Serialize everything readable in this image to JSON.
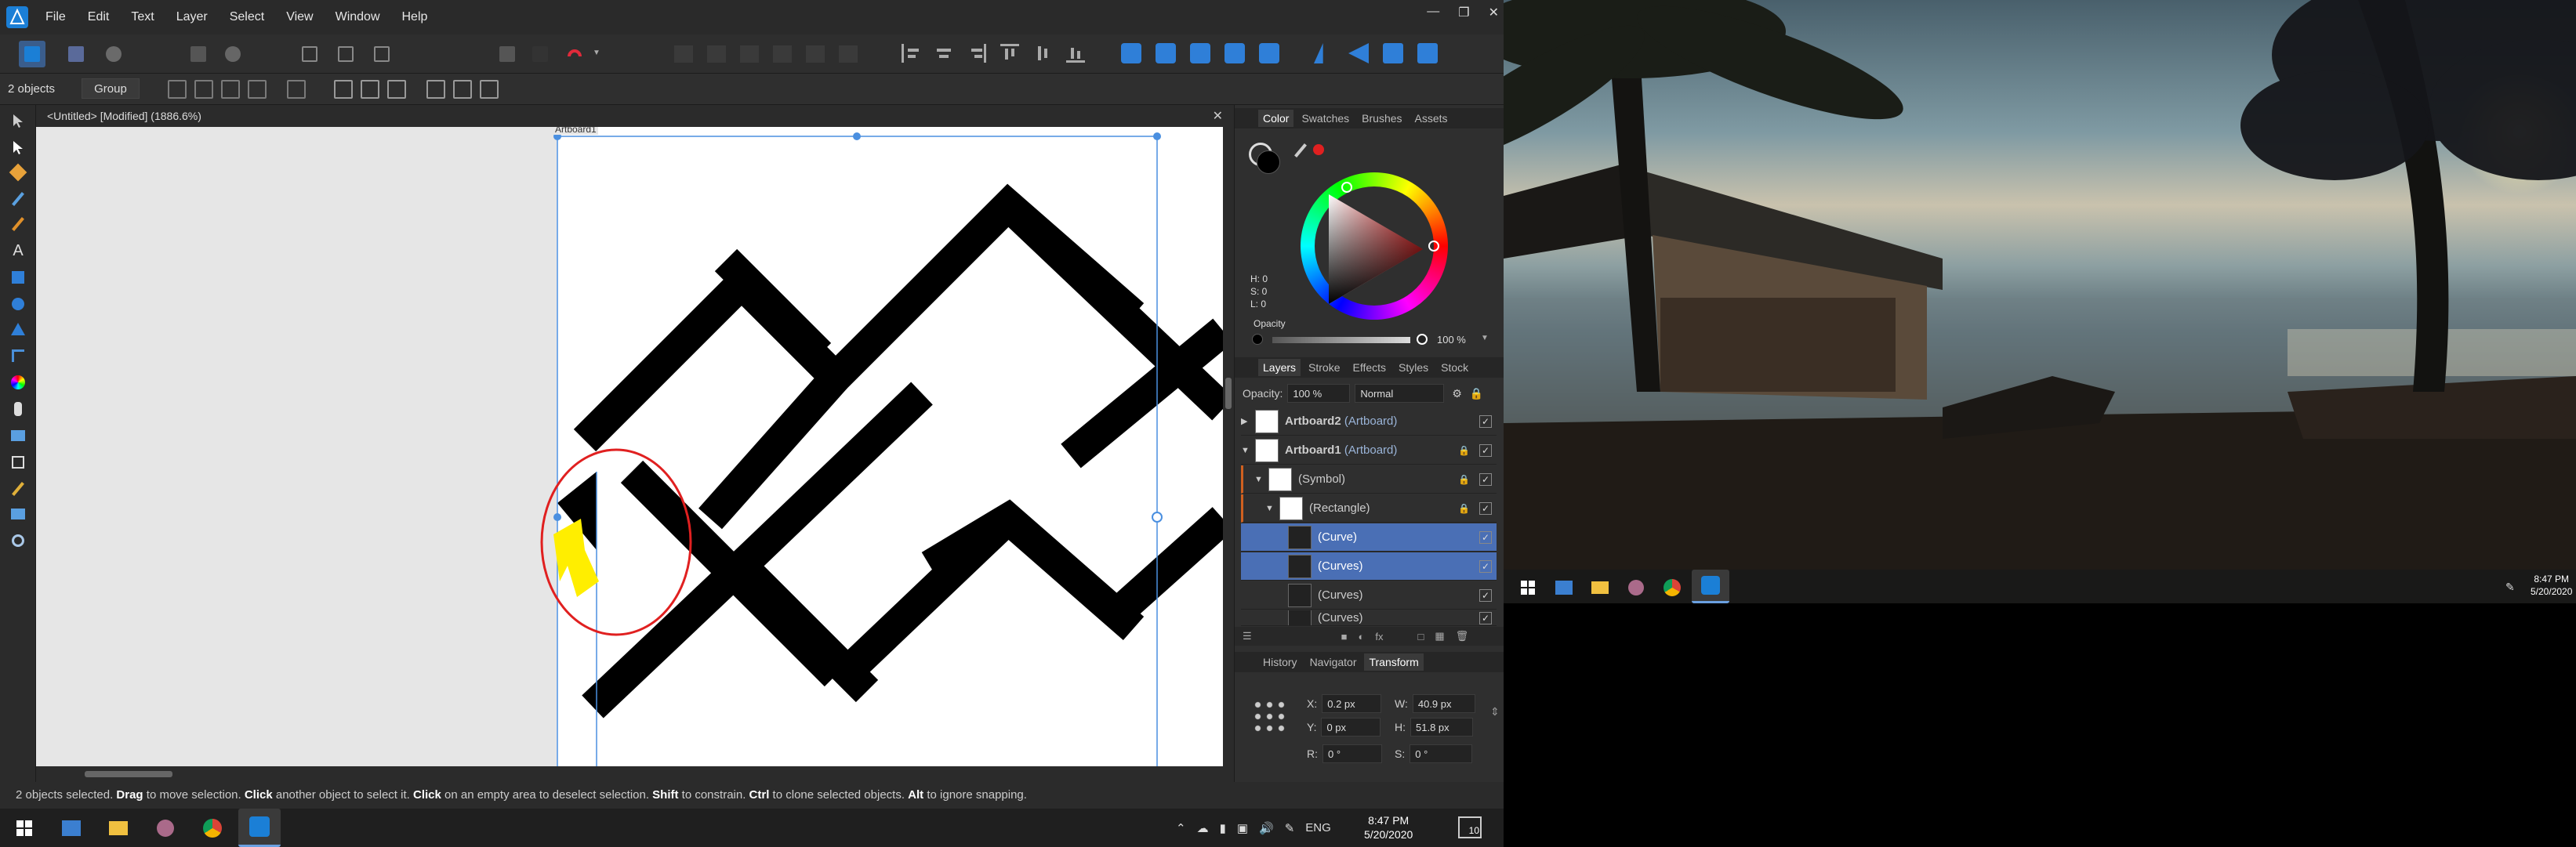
{
  "menu": {
    "items": [
      "File",
      "Edit",
      "Text",
      "Layer",
      "Select",
      "View",
      "Window",
      "Help"
    ]
  },
  "context": {
    "selection_count": "2 objects",
    "group_label": "Group"
  },
  "document": {
    "tab_title": "<Untitled> [Modified] (1886.6%)",
    "artboard_label": "Artboard1"
  },
  "color_panel": {
    "tabs": [
      "Color",
      "Swatches",
      "Brushes",
      "Assets"
    ],
    "h": "H: 0",
    "s": "S: 0",
    "l": "L: 0",
    "opacity_label": "Opacity",
    "opacity_value": "100 %"
  },
  "layers_panel": {
    "tabs": [
      "Layers",
      "Stroke",
      "Effects",
      "Styles",
      "Stock"
    ],
    "opacity_label": "Opacity:",
    "opacity_value": "100 %",
    "blend_mode": "Normal",
    "rows": [
      {
        "name": "Artboard2",
        "type": "(Artboard)"
      },
      {
        "name": "Artboard1",
        "type": "(Artboard)"
      },
      {
        "name": "(Symbol)",
        "type": ""
      },
      {
        "name": "(Rectangle)",
        "type": ""
      },
      {
        "name": "(Curve)",
        "type": ""
      },
      {
        "name": "(Curves)",
        "type": ""
      },
      {
        "name": "(Curves)",
        "type": ""
      },
      {
        "name": "(Curves)",
        "type": ""
      }
    ]
  },
  "transform_panel": {
    "tabs": [
      "History",
      "Navigator",
      "Transform"
    ],
    "x_label": "X:",
    "x_value": "0.2 px",
    "y_label": "Y:",
    "y_value": "0 px",
    "w_label": "W:",
    "w_value": "40.9 px",
    "h_label": "H:",
    "h_value": "51.8 px",
    "r_label": "R:",
    "r_value": "0 °",
    "s_label": "S:",
    "s_value": "0 °"
  },
  "status": {
    "p1": "2 objects selected. ",
    "k1": "Drag",
    "p2": " to move selection. ",
    "k2": "Click",
    "p3": " another object to select it. ",
    "k3": "Click",
    "p4": " on an empty area to deselect selection. ",
    "k4": "Shift",
    "p5": " to constrain. ",
    "k5": "Ctrl",
    "p6": " to clone selected objects. ",
    "k6": "Alt",
    "p7": " to ignore snapping."
  },
  "taskbar_main": {
    "lang": "ENG",
    "time": "8:47 PM",
    "date": "5/20/2020",
    "notif": "10"
  },
  "taskbar_second": {
    "time": "8:47 PM",
    "date": "5/20/2020"
  },
  "colors": {
    "accent": "#4a6fb5",
    "annotation_red": "#e02020",
    "annotation_yellow": "#ffee00"
  }
}
